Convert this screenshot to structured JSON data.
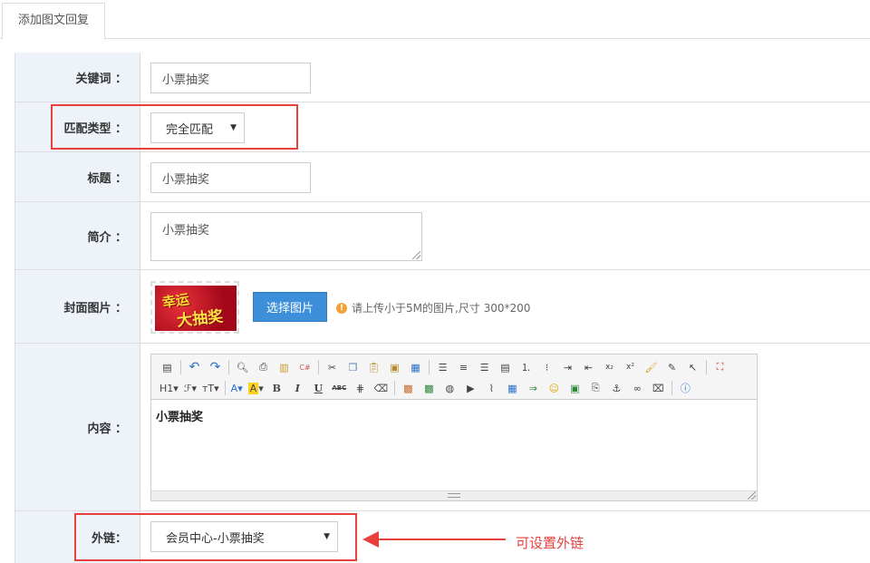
{
  "tab": {
    "label": "添加图文回复"
  },
  "fields": {
    "keyword": {
      "label": "关键词 ：",
      "value": "小票抽奖"
    },
    "match_type": {
      "label": "匹配类型 ：",
      "selected": "完全匹配"
    },
    "title": {
      "label": "标题 ：",
      "value": "小票抽奖"
    },
    "summary": {
      "label": "简介 ：",
      "value": "小票抽奖"
    },
    "cover": {
      "label": "封面图片 ：",
      "image_text_1": "幸运",
      "image_text_2": "大抽奖",
      "upload_label": "选择图片",
      "hint": "请上传小于5M的图片,尺寸 300*200",
      "hint_icon": "!"
    },
    "content": {
      "label": "内容 ：",
      "body": "小票抽奖"
    },
    "external_link": {
      "label": "外链：",
      "selected": "会员中心-小票抽奖"
    }
  },
  "toolbar": {
    "row1": [
      "source-icon",
      "undo-icon",
      "redo-icon",
      "preview-icon",
      "print-icon",
      "template-icon",
      "code-icon",
      "cut-icon",
      "copy-icon",
      "paste-icon",
      "paste-text-icon",
      "paste-word-icon",
      "align-left-icon",
      "align-center-icon",
      "align-right-icon",
      "justify-icon",
      "ordered-list-icon",
      "unordered-list-icon",
      "indent-icon",
      "outdent-icon",
      "subscript-icon",
      "superscript-icon",
      "clear-format-icon",
      "select-all-icon",
      "cursor-icon",
      "fullscreen-icon"
    ],
    "row2_labels": {
      "heading": "H1",
      "font": "ℱ",
      "size": "тT",
      "font_color": "A",
      "highlight": "A",
      "bold": "B",
      "italic": "I",
      "underline": "U",
      "strike": "ABC"
    }
  },
  "annotation": {
    "text": "可设置外链"
  },
  "colors": {
    "accent": "#3d8fd9",
    "annotation": "#e8403d",
    "label_bg": "#eef3fa"
  }
}
